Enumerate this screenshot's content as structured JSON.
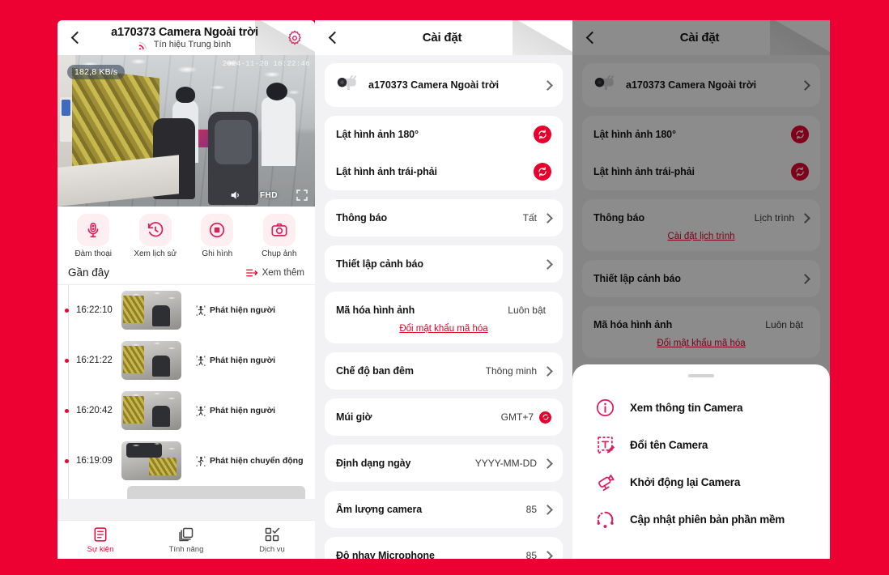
{
  "theme": {
    "brand_red": "#ED0032",
    "accent_red": "#E8002D",
    "panel_bg": "#f2f2f4",
    "card_bg": "#ffffff"
  },
  "live": {
    "header": {
      "title": "a170373 Camera Ngoài trời",
      "subtitle": "Tín hiệu Trung bình",
      "back_icon": "back-chevron-icon",
      "signal_icon": "signal-wifi-icon",
      "gear_icon": "gear-icon"
    },
    "video": {
      "bitrate": "182,8 KB/s",
      "timestamp": "2024-11-20 16:22:46",
      "quality_label": "FHD",
      "audio_icon": "speaker-icon",
      "fullscreen_icon": "fullscreen-icon"
    },
    "actions": [
      {
        "label": "Đàm thoại",
        "icon": "microphone-icon"
      },
      {
        "label": "Xem lịch sử",
        "icon": "history-clock-icon"
      },
      {
        "label": "Ghi hình",
        "icon": "record-icon"
      },
      {
        "label": "Chụp ảnh",
        "icon": "camera-shutter-icon"
      }
    ],
    "recent": {
      "title": "Gần đây",
      "see_more": "Xem thêm",
      "see_more_icon": "filter-list-icon"
    },
    "events": [
      {
        "time": "16:22:10",
        "type": "Phát hiện người",
        "icon": "person-detect-icon"
      },
      {
        "time": "16:21:22",
        "type": "Phát hiện người",
        "icon": "person-detect-icon"
      },
      {
        "time": "16:20:42",
        "type": "Phát hiện người",
        "icon": "person-detect-icon"
      },
      {
        "time": "16:19:09",
        "type": "Phát hiện chuyển động",
        "icon": "motion-detect-icon"
      }
    ],
    "bottom_nav": [
      {
        "label": "Sự kiện",
        "icon": "events-list-icon",
        "active": true
      },
      {
        "label": "Tính năng",
        "icon": "layers-icon",
        "active": false
      },
      {
        "label": "Dịch vụ",
        "icon": "services-grid-icon",
        "active": false
      }
    ]
  },
  "settings": {
    "header": {
      "title": "Cài đặt",
      "back_icon": "back-chevron-icon"
    },
    "device": {
      "name": "a170373 Camera Ngoài trời",
      "icon": "bullet-camera-icon"
    },
    "flip_rows": [
      {
        "label": "Lật hình ảnh 180°",
        "icon": "flip-rotate-icon"
      },
      {
        "label": "Lật hình ảnh trái-phải",
        "icon": "flip-rotate-icon"
      }
    ],
    "rows": [
      {
        "label": "Thông báo",
        "value": "Tất",
        "chevron": true,
        "sublink": null
      },
      {
        "label": "Thiết lập cảnh báo",
        "value": "",
        "chevron": true,
        "sublink": null
      },
      {
        "label": "Mã hóa hình ảnh",
        "value": "Luôn bật",
        "chevron": false,
        "sublink": "Đổi mật khẩu mã hóa"
      },
      {
        "label": "Chế độ ban đêm",
        "value": "Thông minh",
        "chevron": true,
        "sublink": null
      },
      {
        "label": "Múi giờ",
        "value": "GMT+7",
        "chevron": false,
        "sublink": null,
        "dot_button": true
      },
      {
        "label": "Định dạng ngày",
        "value": "YYYY-MM-DD",
        "chevron": true,
        "sublink": null
      },
      {
        "label": "Âm lượng camera",
        "value": "85",
        "chevron": true,
        "sublink": null
      },
      {
        "label": "Độ nhạy Microphone",
        "value": "85",
        "chevron": true,
        "sublink": null
      }
    ]
  },
  "menu_screen": {
    "header": {
      "title": "Cài đặt",
      "back_icon": "back-chevron-icon"
    },
    "device": {
      "name": "a170373 Camera Ngoài trời",
      "icon": "bullet-camera-icon"
    },
    "flip_rows": [
      {
        "label": "Lật hình ảnh 180°",
        "icon": "flip-rotate-icon"
      },
      {
        "label": "Lật hình ảnh trái-phải",
        "icon": "flip-rotate-icon"
      }
    ],
    "rows": [
      {
        "label": "Thông báo",
        "value": "Lịch trình",
        "chevron": true,
        "sublink": "Cài đặt lịch trình"
      },
      {
        "label": "Thiết lập cảnh báo",
        "value": "",
        "chevron": true,
        "sublink": null
      },
      {
        "label": "Mã hóa hình ảnh",
        "value": "Luôn bật",
        "chevron": false,
        "sublink": "Đổi mật khẩu mã hóa"
      }
    ],
    "sheet_items": [
      {
        "label": "Xem thông tin Camera",
        "icon": "info-circle-icon"
      },
      {
        "label": "Đổi tên Camera",
        "icon": "rename-edit-icon"
      },
      {
        "label": "Khởi động lại Camera",
        "icon": "camera-restart-icon"
      },
      {
        "label": "Cập nhật phiên bản phần mềm",
        "icon": "update-refresh-icon"
      }
    ]
  }
}
